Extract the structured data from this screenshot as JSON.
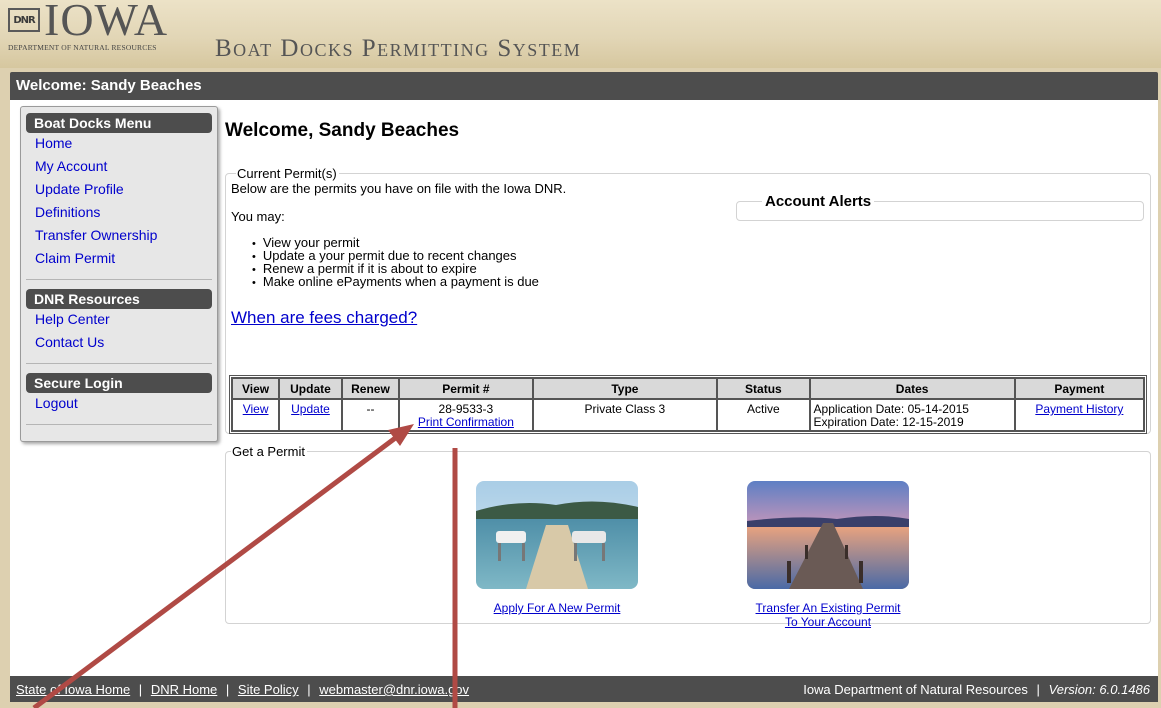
{
  "header": {
    "logo_mark": "DNR",
    "logo_word": "IOWA",
    "logo_dept": "DEPARTMENT OF NATURAL RESOURCES",
    "system_title": "Boat Docks Permitting System"
  },
  "welcome_bar": "Welcome: Sandy Beaches",
  "sidebar": {
    "sections": [
      {
        "title": "Boat Docks Menu",
        "items": [
          "Home",
          "My Account",
          "Update Profile",
          "Definitions",
          "Transfer Ownership",
          "Claim Permit"
        ]
      },
      {
        "title": "DNR Resources",
        "items": [
          "Help Center",
          "Contact Us"
        ]
      },
      {
        "title": "Secure Login",
        "items": [
          "Logout"
        ]
      }
    ]
  },
  "main": {
    "page_title": "Welcome, Sandy Beaches",
    "current": {
      "legend": "Current Permit(s)",
      "description": "Below are the permits you have on file with the Iowa DNR.",
      "you_may": "You may:",
      "bullets": [
        "View your permit",
        "Update a your permit due to recent changes",
        "Renew a permit if it is about to expire",
        "Make online ePayments when a payment is due"
      ],
      "fees_link": "When are fees charged?",
      "alerts_title": "Account Alerts"
    },
    "table": {
      "headers": [
        "View",
        "Update",
        "Renew",
        "Permit #",
        "Type",
        "Status",
        "Dates",
        "Payment"
      ],
      "rows": [
        {
          "view": "View",
          "update": "Update",
          "renew": "--",
          "permit_number": "28-9533-3",
          "print_link": "Print Confirmation",
          "type": "Private Class 3",
          "status": "Active",
          "application_date": "Application Date: 05-14-2015",
          "expiration_date": "Expiration Date: 12-15-2019",
          "payment": "Payment History"
        }
      ]
    },
    "get_permit": {
      "legend": "Get a Permit",
      "apply_label": "Apply For A New Permit",
      "transfer_label_line1": "Transfer An Existing Permit",
      "transfer_label_line2": "To Your Account"
    }
  },
  "footer": {
    "links": [
      "State of Iowa Home",
      "DNR Home",
      "Site Policy",
      "webmaster@dnr.iowa.gov"
    ],
    "separator": "|",
    "org": "Iowa Department of Natural Resources",
    "version": "Version: 6.0.1486"
  },
  "colors": {
    "bar": "#4d4d4d",
    "link": "#0000cc",
    "header_bg": "#e2d6b6",
    "arrow": "#b04a45"
  }
}
